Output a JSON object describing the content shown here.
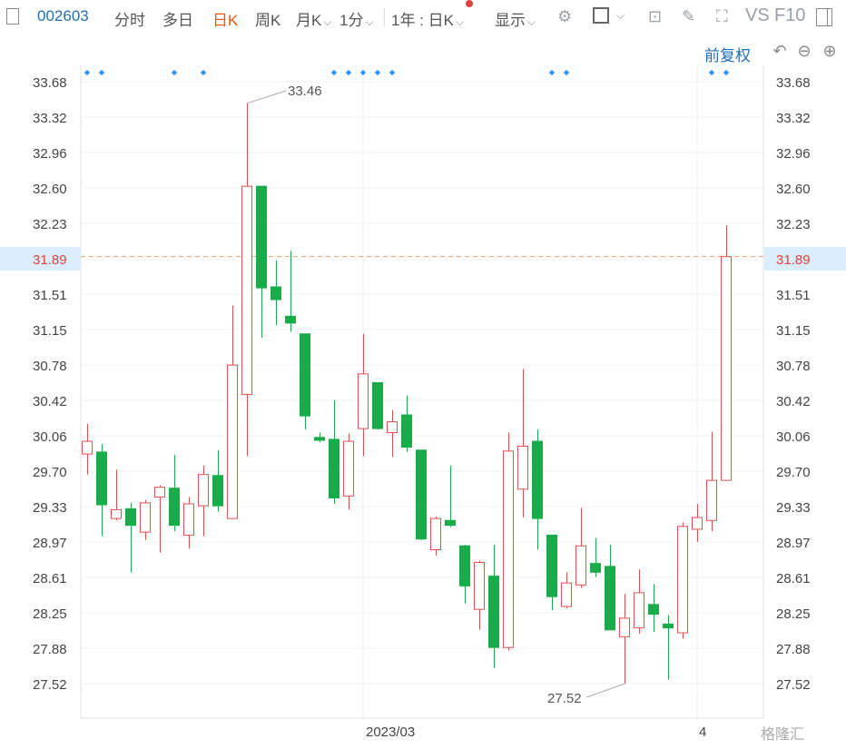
{
  "toolbar": {
    "stock_code": "002603",
    "tabs": [
      "分时",
      "多日",
      "日K",
      "周K",
      "月K"
    ],
    "active_tab": "日K",
    "minute_select": "1分",
    "range_select": "1年 : 日K",
    "display_label": "显示",
    "vs_label": "VS",
    "f10_label": "F10"
  },
  "adjust_label": "前复权",
  "colors": {
    "up": "#d9534f",
    "down": "#1aab4a",
    "current_line": "#f0a070",
    "current_text": "#e0413a",
    "current_bg": "#dbeefc",
    "marker": "#1e90ff"
  },
  "chart_data": {
    "type": "candlestick",
    "y_ticks": [
      "33.68",
      "33.32",
      "32.96",
      "32.60",
      "32.23",
      "31.89",
      "31.51",
      "31.15",
      "30.78",
      "30.42",
      "30.06",
      "29.70",
      "29.33",
      "28.97",
      "28.61",
      "28.25",
      "27.88",
      "27.52"
    ],
    "ylim": [
      27.52,
      33.68
    ],
    "current_price": "31.89",
    "x_labels": [
      "2023/03",
      "4"
    ],
    "annotations": {
      "high": "33.46",
      "low": "27.52"
    },
    "grid": true,
    "candles": [
      {
        "o": 29.87,
        "h": 30.18,
        "l": 29.66,
        "c": 30.0
      },
      {
        "o": 29.89,
        "h": 29.97,
        "l": 29.03,
        "c": 29.35
      },
      {
        "o": 29.21,
        "h": 29.71,
        "l": 29.19,
        "c": 29.3
      },
      {
        "o": 29.31,
        "h": 29.37,
        "l": 28.66,
        "c": 29.14
      },
      {
        "o": 29.07,
        "h": 29.4,
        "l": 28.99,
        "c": 29.37
      },
      {
        "o": 29.43,
        "h": 29.55,
        "l": 28.86,
        "c": 29.53
      },
      {
        "o": 29.52,
        "h": 29.86,
        "l": 29.08,
        "c": 29.14
      },
      {
        "o": 29.04,
        "h": 29.43,
        "l": 28.9,
        "c": 29.36
      },
      {
        "o": 29.34,
        "h": 29.75,
        "l": 29.03,
        "c": 29.66
      },
      {
        "o": 29.65,
        "h": 29.91,
        "l": 29.28,
        "c": 29.34
      },
      {
        "o": 29.21,
        "h": 31.39,
        "l": 29.21,
        "c": 30.78
      },
      {
        "o": 30.48,
        "h": 33.46,
        "l": 29.85,
        "c": 32.61
      },
      {
        "o": 32.61,
        "h": 32.61,
        "l": 31.06,
        "c": 31.57
      },
      {
        "o": 31.58,
        "h": 31.85,
        "l": 31.19,
        "c": 31.45
      },
      {
        "o": 31.28,
        "h": 31.95,
        "l": 31.12,
        "c": 31.21
      },
      {
        "o": 31.1,
        "h": 31.1,
        "l": 30.12,
        "c": 30.26
      },
      {
        "o": 30.04,
        "h": 30.09,
        "l": 29.99,
        "c": 30.01
      },
      {
        "o": 30.02,
        "h": 30.42,
        "l": 29.36,
        "c": 29.42
      },
      {
        "o": 29.44,
        "h": 30.08,
        "l": 29.3,
        "c": 30.0
      },
      {
        "o": 30.13,
        "h": 31.1,
        "l": 29.85,
        "c": 30.69
      },
      {
        "o": 30.6,
        "h": 30.6,
        "l": 30.12,
        "c": 30.13
      },
      {
        "o": 30.09,
        "h": 30.32,
        "l": 29.84,
        "c": 30.2
      },
      {
        "o": 30.27,
        "h": 30.47,
        "l": 29.89,
        "c": 29.94
      },
      {
        "o": 29.91,
        "h": 29.91,
        "l": 28.99,
        "c": 29.0
      },
      {
        "o": 28.89,
        "h": 29.23,
        "l": 28.83,
        "c": 29.21
      },
      {
        "o": 29.19,
        "h": 29.75,
        "l": 29.12,
        "c": 29.14
      },
      {
        "o": 28.93,
        "h": 28.94,
        "l": 28.34,
        "c": 28.52
      },
      {
        "o": 28.28,
        "h": 28.78,
        "l": 28.07,
        "c": 28.76
      },
      {
        "o": 28.62,
        "h": 28.94,
        "l": 27.68,
        "c": 27.89
      },
      {
        "o": 27.89,
        "h": 30.09,
        "l": 27.86,
        "c": 29.9
      },
      {
        "o": 29.51,
        "h": 30.74,
        "l": 29.22,
        "c": 29.95
      },
      {
        "o": 30.0,
        "h": 30.12,
        "l": 28.89,
        "c": 29.21
      },
      {
        "o": 29.04,
        "h": 29.04,
        "l": 28.27,
        "c": 28.41
      },
      {
        "o": 28.31,
        "h": 28.66,
        "l": 28.29,
        "c": 28.55
      },
      {
        "o": 28.53,
        "h": 29.32,
        "l": 28.5,
        "c": 28.93
      },
      {
        "o": 28.75,
        "h": 29.01,
        "l": 28.61,
        "c": 28.66
      },
      {
        "o": 28.72,
        "h": 28.94,
        "l": 28.08,
        "c": 28.07
      },
      {
        "o": 28.0,
        "h": 28.44,
        "l": 27.52,
        "c": 28.19
      },
      {
        "o": 28.09,
        "h": 28.69,
        "l": 28.03,
        "c": 28.45
      },
      {
        "o": 28.33,
        "h": 28.54,
        "l": 28.05,
        "c": 28.23
      },
      {
        "o": 28.13,
        "h": 28.22,
        "l": 27.56,
        "c": 28.09
      },
      {
        "o": 28.04,
        "h": 29.17,
        "l": 27.98,
        "c": 29.13
      },
      {
        "o": 29.1,
        "h": 29.36,
        "l": 28.97,
        "c": 29.22
      },
      {
        "o": 29.19,
        "h": 30.1,
        "l": 29.08,
        "c": 29.6
      },
      {
        "o": 29.6,
        "h": 32.21,
        "l": 29.6,
        "c": 31.89
      }
    ],
    "marker_candles": [
      0,
      1,
      6,
      8,
      17,
      18,
      19,
      20,
      21,
      32,
      33,
      43,
      44
    ]
  },
  "watermark": "格隆汇"
}
